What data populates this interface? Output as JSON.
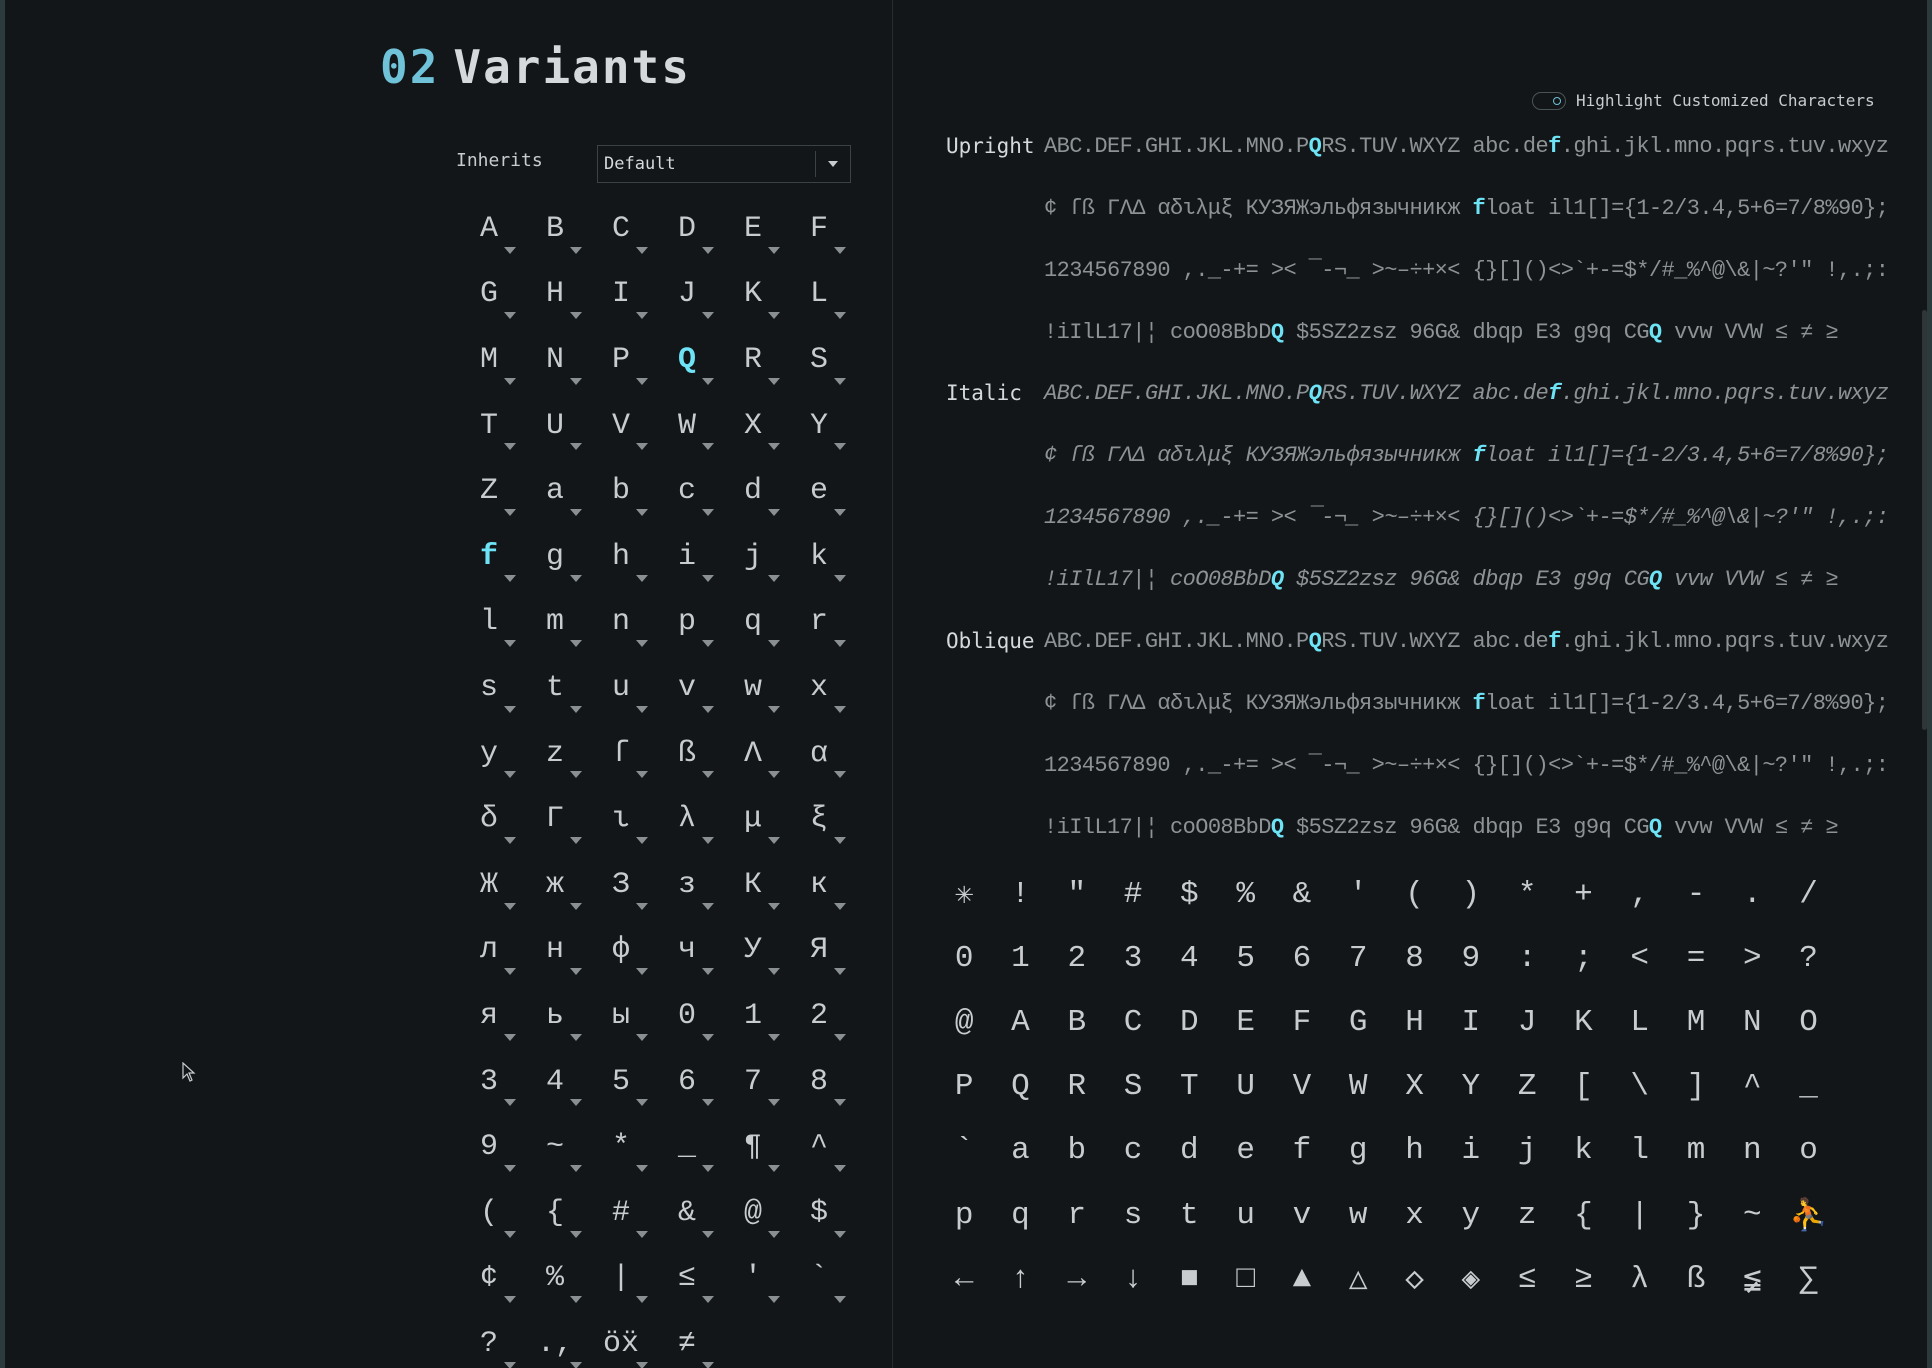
{
  "section": {
    "number": "02",
    "title": "Variants"
  },
  "inherits": {
    "label": "Inherits",
    "value": "Default"
  },
  "variant_glyphs": [
    "A",
    "B",
    "C",
    "D",
    "E",
    "F",
    "G",
    "H",
    "I",
    "J",
    "K",
    "L",
    "M",
    "N",
    "P",
    "Q",
    "R",
    "S",
    "T",
    "U",
    "V",
    "W",
    "X",
    "Y",
    "Z",
    "a",
    "b",
    "c",
    "d",
    "e",
    "f",
    "g",
    "h",
    "i",
    "j",
    "k",
    "l",
    "m",
    "n",
    "p",
    "q",
    "r",
    "s",
    "t",
    "u",
    "v",
    "w",
    "x",
    "y",
    "z",
    "ſ",
    "ß",
    "Λ",
    "α",
    "δ",
    "Γ",
    "ι",
    "λ",
    "μ",
    "ξ",
    "Ж",
    "ж",
    "З",
    "з",
    "К",
    "к",
    "л",
    "н",
    "ф",
    "ч",
    "У",
    "Я",
    "я",
    "ь",
    "ы",
    "0",
    "1",
    "2",
    "3",
    "4",
    "5",
    "6",
    "7",
    "8",
    "9",
    "~",
    "*",
    "_",
    "¶",
    "^",
    "(",
    "{",
    "#",
    "&",
    "@",
    "$",
    "¢",
    "%",
    "|",
    "≤",
    "'",
    "`",
    "?",
    ".,",
    "öẍ",
    "≠"
  ],
  "highlighted_variants": [
    "Q",
    "f"
  ],
  "highlight_toggle": {
    "label": "Highlight Customized Characters"
  },
  "samples": [
    {
      "style": "Upright",
      "lines": [
        [
          "ABC.DEF.GHI.JKL.MNO.P",
          "Q",
          "RS.TUV.WXYZ abc.de",
          "f",
          ".ghi.jkl.mno.pqrs.tuv.wxyz"
        ],
        [
          "¢ ſß ΓΛΔ αδιλμξ КУЗЯЖэльфязычникж ",
          "f",
          "loat il1[]={1-2/3.4,5+6=7/8%90};"
        ],
        [
          "1234567890 ,._-+= >< ¯-¬_ >~–÷+×< {}[]()<>`+-=$*/#_%^@\\&|~?'\" !,.;:"
        ],
        [
          "!iIlL17|¦ coO08BbD",
          "Q",
          " $5SZ2zsz 96G& dbqp E3 g9q CG",
          "Q",
          " vvw VVW ≤ ≠ ≥"
        ]
      ]
    },
    {
      "style": "Italic",
      "lines": [
        [
          "ABC.DEF.GHI.JKL.MNO.P",
          "Q",
          "RS.TUV.WXYZ abc.de",
          "f",
          ".ghi.jkl.mno.pqrs.tuv.wxyz"
        ],
        [
          "¢ ſß ΓΛΔ αδιλμξ КУЗЯЖэльфязычникж ",
          "f",
          "loat il1[]={1-2/3.4,5+6=7/8%90};"
        ],
        [
          "1234567890 ,._-+= >< ¯-¬_ >~–÷+×< {}[]()<>`+-=$*/#_%^@\\&|~?'\" !,.;:"
        ],
        [
          "!iIlL17|¦ coO08BbD",
          "Q",
          " $5SZ2zsz 96G& dbqp E3 g9q CG",
          "Q",
          " vvw VVW ≤ ≠ ≥"
        ]
      ]
    },
    {
      "style": "Oblique",
      "lines": [
        [
          "ABC.DEF.GHI.JKL.MNO.P",
          "Q",
          "RS.TUV.WXYZ abc.de",
          "f",
          ".ghi.jkl.mno.pqrs.tuv.wxyz"
        ],
        [
          "¢ ſß ΓΛΔ αδιλμξ КУЗЯЖэльфязычникж ",
          "f",
          "loat il1[]={1-2/3.4,5+6=7/8%90};"
        ],
        [
          "1234567890 ,._-+= >< ¯-¬_ >~–÷+×< {}[]()<>`+-=$*/#_%^@\\&|~?'\" !,.;:"
        ],
        [
          "!iIlL17|¦ coO08BbD",
          "Q",
          " $5SZ2zsz 96G& dbqp E3 g9q CG",
          "Q",
          " vvw VVW ≤ ≠ ≥"
        ]
      ]
    }
  ],
  "ascii_glyphs": [
    "✳",
    "!",
    "\"",
    "#",
    "$",
    "%",
    "&",
    "'",
    "(",
    ")",
    "*",
    "+",
    ",",
    "-",
    ".",
    "/",
    "0",
    "1",
    "2",
    "3",
    "4",
    "5",
    "6",
    "7",
    "8",
    "9",
    ":",
    ";",
    "<",
    "=",
    ">",
    "?",
    "@",
    "A",
    "B",
    "C",
    "D",
    "E",
    "F",
    "G",
    "H",
    "I",
    "J",
    "K",
    "L",
    "M",
    "N",
    "O",
    "P",
    "Q",
    "R",
    "S",
    "T",
    "U",
    "V",
    "W",
    "X",
    "Y",
    "Z",
    "[",
    "\\",
    "]",
    "^",
    "_",
    "`",
    "a",
    "b",
    "c",
    "d",
    "e",
    "f",
    "g",
    "h",
    "i",
    "j",
    "k",
    "l",
    "m",
    "n",
    "o",
    "p",
    "q",
    "r",
    "s",
    "t",
    "u",
    "v",
    "w",
    "x",
    "y",
    "z",
    "{",
    "|",
    "}",
    "~",
    "⛹",
    "←",
    "↑",
    "→",
    "↓",
    "■",
    "□",
    "▲",
    "△",
    "◇",
    "◈",
    "≤",
    "≥",
    "λ",
    "ß",
    "≨",
    "∑"
  ],
  "colors": {
    "background": "#121618",
    "accent": "#6ee3f5",
    "section_number": "#6fc2d8",
    "text": "#c9ccce",
    "sample_text": "#8d9295"
  },
  "icons": {
    "dropdown": "chevron-down-icon",
    "cell_menu": "triangle-down-icon",
    "toggle": "toggle-switch-icon",
    "cursor": "mouse-pointer-icon"
  }
}
